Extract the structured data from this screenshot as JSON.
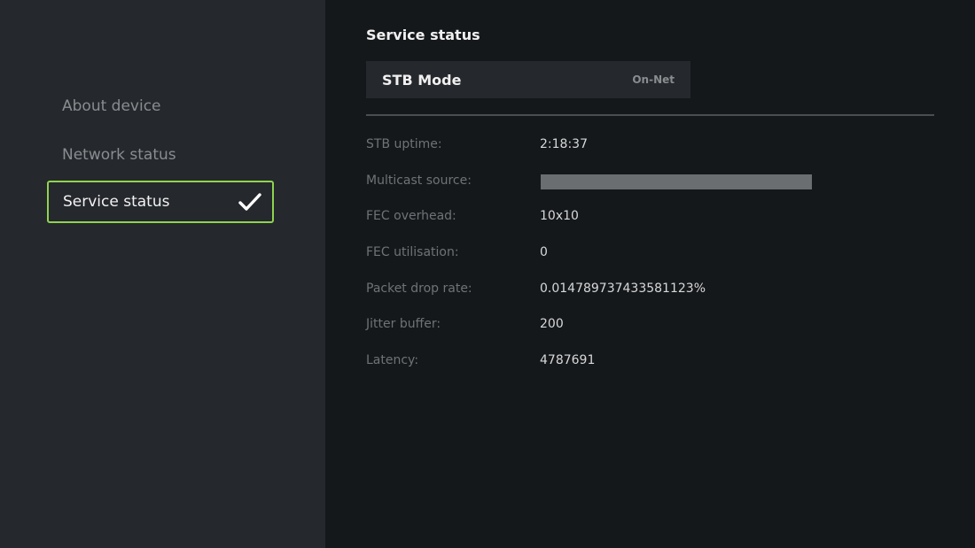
{
  "sidebar": {
    "items": [
      {
        "label": "About device"
      },
      {
        "label": "Network status"
      },
      {
        "label": "Service status"
      }
    ]
  },
  "main": {
    "title": "Service status",
    "mode": {
      "label": "STB Mode",
      "value": "On-Net"
    },
    "rows": [
      {
        "key": "STB uptime:",
        "value": "2:18:37"
      },
      {
        "key": "Multicast source:",
        "value": ""
      },
      {
        "key": "FEC overhead:",
        "value": "10x10"
      },
      {
        "key": "FEC utilisation:",
        "value": "0"
      },
      {
        "key": "Packet drop rate:",
        "value": "0.014789737433581123%"
      },
      {
        "key": "Jitter buffer:",
        "value": "200"
      },
      {
        "key": "Latency:",
        "value": "4787691"
      }
    ]
  },
  "colors": {
    "accent": "#8fd44f",
    "sidebar_bg": "#25282c",
    "main_bg": "#15181b"
  }
}
